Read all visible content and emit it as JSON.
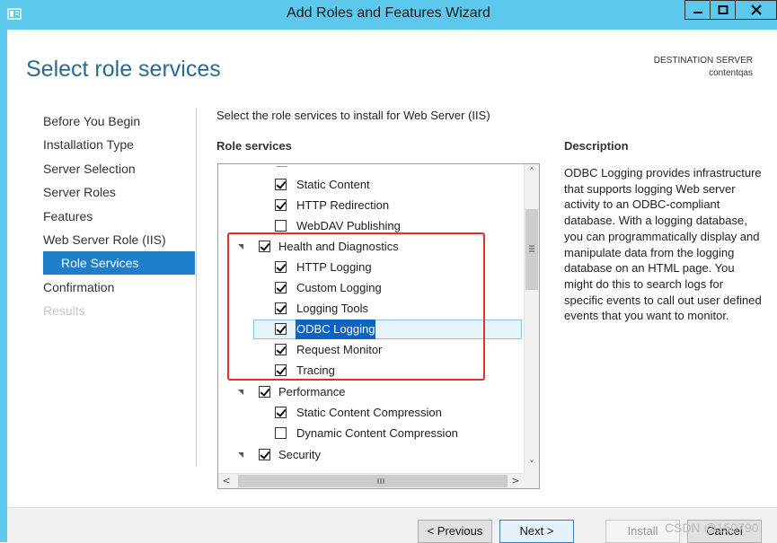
{
  "window": {
    "title": "Add Roles and Features Wizard"
  },
  "page": {
    "heading": "Select role services",
    "destination_label": "DESTINATION SERVER",
    "destination_server": "contentqas",
    "instruction": "Select the role services to install for Web Server (IIS)"
  },
  "nav": {
    "items": [
      {
        "label": "Before You Begin",
        "state": "normal"
      },
      {
        "label": "Installation Type",
        "state": "normal"
      },
      {
        "label": "Server Selection",
        "state": "normal"
      },
      {
        "label": "Server Roles",
        "state": "normal"
      },
      {
        "label": "Features",
        "state": "normal"
      },
      {
        "label": "Web Server Role (IIS)",
        "state": "normal"
      },
      {
        "label": "Role Services",
        "state": "active"
      },
      {
        "label": "Confirmation",
        "state": "normal"
      },
      {
        "label": "Results",
        "state": "disabled"
      }
    ]
  },
  "role_services": {
    "header": "Role services",
    "items": [
      {
        "label": "Static Content",
        "checked": true,
        "level": 2
      },
      {
        "label": "HTTP Redirection",
        "checked": true,
        "level": 2
      },
      {
        "label": "WebDAV Publishing",
        "checked": false,
        "level": 2
      },
      {
        "label": "Health and Diagnostics",
        "checked": true,
        "level": 1,
        "expanded": true
      },
      {
        "label": "HTTP Logging",
        "checked": true,
        "level": 2
      },
      {
        "label": "Custom Logging",
        "checked": true,
        "level": 2
      },
      {
        "label": "Logging Tools",
        "checked": true,
        "level": 2
      },
      {
        "label": "ODBC Logging",
        "checked": true,
        "level": 2,
        "selected": true
      },
      {
        "label": "Request Monitor",
        "checked": true,
        "level": 2
      },
      {
        "label": "Tracing",
        "checked": true,
        "level": 2
      },
      {
        "label": "Performance",
        "checked": true,
        "level": 1,
        "expanded": true
      },
      {
        "label": "Static Content Compression",
        "checked": true,
        "level": 2
      },
      {
        "label": "Dynamic Content Compression",
        "checked": false,
        "level": 2
      },
      {
        "label": "Security",
        "checked": true,
        "level": 1,
        "expanded": true
      }
    ]
  },
  "description": {
    "header": "Description",
    "text": "ODBC Logging provides infrastructure that supports logging Web server activity to an ODBC-compliant database. With a logging database, you can programmatically display and manipulate data from the logging database on an HTML page. You might do this to search logs for specific events to call out user defined events that you want to monitor."
  },
  "buttons": {
    "previous": "< Previous",
    "next": "Next >",
    "install": "Install",
    "cancel": "Cancel"
  },
  "watermark": "CSDN @150790",
  "colors": {
    "titlebar": "#5bc8ec",
    "heading": "#2a6a8f",
    "nav_active": "#1e7fc8",
    "selection": "#0a64c8",
    "highlight_box": "#e52d2d"
  }
}
